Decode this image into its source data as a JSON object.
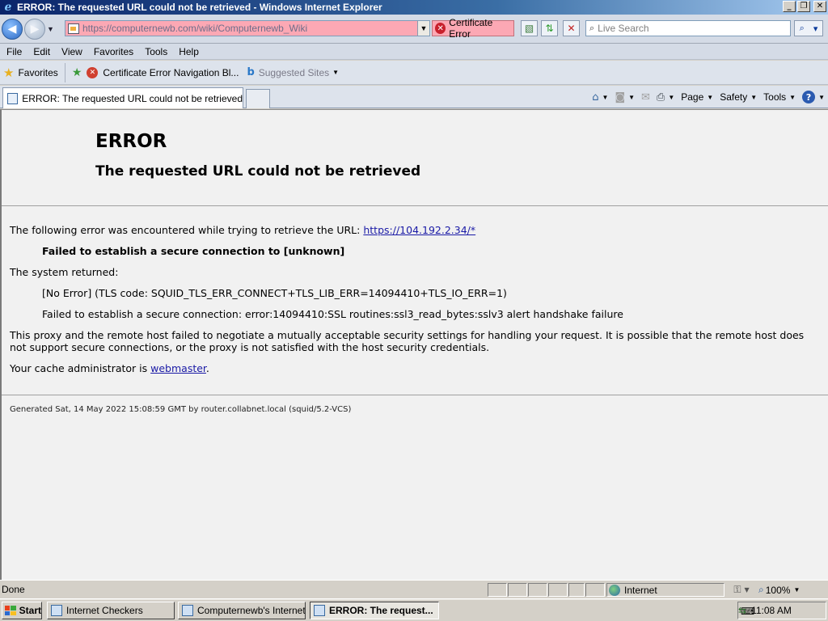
{
  "window": {
    "title": "ERROR: The requested URL could not be retrieved - Windows Internet Explorer",
    "minimize": "_",
    "restore": "❐",
    "close": "✕"
  },
  "nav": {
    "url": "https://computernewb.com/wiki/Computernewb_Wiki",
    "certificate_error_label": "Certificate Error",
    "search_placeholder": "Live Search"
  },
  "menu": [
    "File",
    "Edit",
    "View",
    "Favorites",
    "Tools",
    "Help"
  ],
  "favorites_bar": {
    "favorites_label": "Favorites",
    "items": [
      "Certificate Error Navigation Bl...",
      "Suggested Sites"
    ]
  },
  "tab": {
    "label": "ERROR: The requested URL could not be retrieved"
  },
  "command_bar": {
    "page": "Page",
    "safety": "Safety",
    "tools": "Tools"
  },
  "page": {
    "heading": "ERROR",
    "subheading": "The requested URL could not be retrieved",
    "intro": "The following error was encountered while trying to retrieve the URL:",
    "url_link": "https://104.192.2.34/*",
    "fail_msg": "Failed to establish a secure connection to [unknown]",
    "system_returned": "The system returned:",
    "tls_code": "[No Error] (TLS code: SQUID_TLS_ERR_CONNECT+TLS_LIB_ERR=14094410+TLS_IO_ERR=1)",
    "ssl_error": "Failed to establish a secure connection: error:14094410:SSL routines:ssl3_read_bytes:sslv3 alert handshake failure",
    "explanation": "This proxy and the remote host failed to negotiate a mutually acceptable security settings for handling your request. It is possible that the remote host does not support secure connections, or the proxy is not satisfied with the host security credentials.",
    "admin_prefix": "Your cache administrator is",
    "admin_link": "webmaster",
    "admin_suffix": ".",
    "footer": "Generated Sat, 14 May 2022 15:08:59 GMT by router.collabnet.local (squid/5.2-VCS)"
  },
  "status": {
    "text": "Done",
    "zone": "Internet",
    "zoom": "100%"
  },
  "taskbar": {
    "start": "Start",
    "tasks": [
      "Internet Checkers",
      "Computernewb's Internet ...",
      "ERROR: The request..."
    ],
    "clock": "11:08 AM"
  }
}
